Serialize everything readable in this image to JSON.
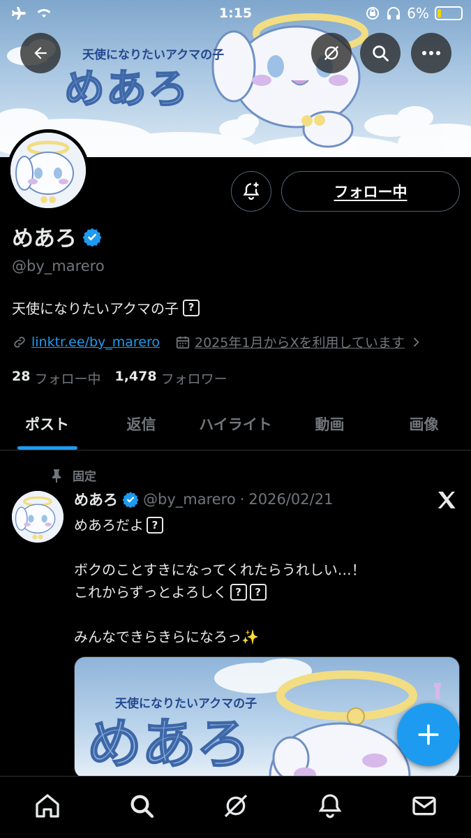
{
  "status_bar": {
    "time": "1:15",
    "battery_percent": "6%",
    "battery_level": 0.06
  },
  "banner": {
    "subtitle": "天使になりたいアクマの子",
    "logo_text": "めあろ"
  },
  "profile": {
    "display_name": "めあろ",
    "verified": true,
    "handle": "@by_marero",
    "bio": "天使になりたいアクマの子",
    "bio_emoji_placeholder": "?",
    "link": "linktr.ee/by_marero",
    "joined": "2025年1月からXを利用しています",
    "following_count": "28",
    "following_label": "フォロー中",
    "followers_count": "1,478",
    "followers_label": "フォロワー",
    "follow_button_label": "フォロー中"
  },
  "tabs": [
    {
      "label": "ポスト",
      "active": true
    },
    {
      "label": "返信",
      "active": false
    },
    {
      "label": "ハイライト",
      "active": false
    },
    {
      "label": "動画",
      "active": false
    },
    {
      "label": "画像",
      "active": false
    }
  ],
  "post": {
    "pinned_label": "固定",
    "author": "めあろ",
    "handle": "@by_marero",
    "separator": "·",
    "date": "2026/02/21",
    "lines": [
      "めあろだよ",
      "",
      "ボクのことすきになってくれたらうれしい…！",
      "これからずっとよろしく",
      "",
      "みんなできらきらになろっ✨"
    ],
    "media": {
      "subtitle": "天使になりたいアクマの子",
      "logo_text": "めあろ"
    }
  },
  "colors": {
    "accent": "#1d9bf0",
    "background": "#000000",
    "muted": "#71767b",
    "text": "#e7e9ea"
  },
  "icons": [
    "back-icon",
    "grok-icon",
    "search-icon",
    "more-icon",
    "bell-plus-icon",
    "verified-icon",
    "link-icon",
    "calendar-icon",
    "chevron-right-icon",
    "pin-icon",
    "x-logo-icon",
    "plus-icon",
    "home-icon",
    "search-nav-icon",
    "grok-nav-icon",
    "bell-icon",
    "mail-icon"
  ]
}
